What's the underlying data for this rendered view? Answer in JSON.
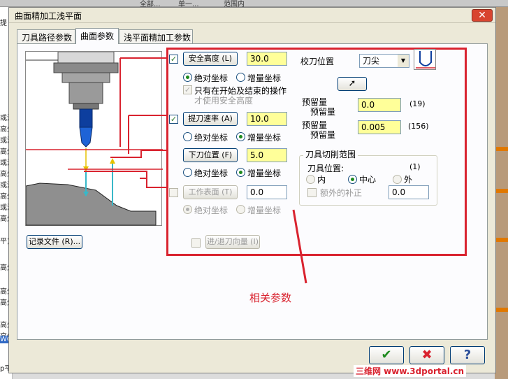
{
  "background": {
    "toolbar_items": [
      "全部...",
      "单一...",
      "范围内"
    ],
    "left_texts": [
      "提",
      "或清",
      "高外",
      "或清",
      "高外",
      "或清",
      "高外",
      "或清",
      "高外",
      "或清",
      "高外",
      "平)",
      "高外",
      "高外",
      "高外",
      "高外",
      "高外",
      "WCS",
      "p平"
    ]
  },
  "dialog": {
    "title": "曲面精加工浅平面",
    "close_glyph": "✕",
    "tabs": [
      "刀具路径参数",
      "曲面参数",
      "浅平面精加工参数"
    ]
  },
  "form": {
    "safe_height": {
      "label": "安全高度 (L)",
      "value": "30.0",
      "checked": "✓"
    },
    "safe_abs": "绝对坐标",
    "safe_inc": "增量坐标",
    "only_start_end": "只有在开始及结束的操作",
    "only_start_end2": "才使用安全高度",
    "retract": {
      "label": "提刀速率 (A)",
      "value": "10.0",
      "checked": "✓"
    },
    "retract_abs": "绝对坐标",
    "retract_inc": "增量坐标",
    "feed_plane": {
      "label": "下刀位置 (F)",
      "value": "5.0"
    },
    "feed_abs": "绝对坐标",
    "feed_inc": "增量坐标",
    "top_of_stock": {
      "label": "工作表面 (T)",
      "value": "0.0"
    },
    "top_abs": "绝对坐标",
    "top_inc": "增量坐标",
    "tip_comp_label": "校刀位置",
    "tip_comp_value": "刀尖",
    "stock_to_leave_1a": "预留量",
    "stock_to_leave_1b": "预留量",
    "stock_value_1": "0.0",
    "stock_count_1": "(19)",
    "stock_to_leave_2a": "预留量",
    "stock_to_leave_2b": "预留量",
    "stock_value_2": "0.005",
    "stock_count_2": "(156)",
    "cut_range_title": "刀具切削范围",
    "tool_position_label": "刀具位置:",
    "tool_position_count": "(1)",
    "pos_inside": "内",
    "pos_center": "中心",
    "pos_outside": "外",
    "extra_comp_label": "额外的补正",
    "extra_comp_value": "0.0",
    "entry_exit_btn": "进/退刀向量 (I)",
    "record_file_btn": "记录文件 (R)..."
  },
  "annotation": "相关参数",
  "buttons": {
    "ok": "✔",
    "cancel": "✖",
    "help": "?"
  },
  "watermark": "三维网 www.3dportal.cn",
  "colors": {
    "highlight_red": "#d9232f",
    "input_yellow": "#ffff99"
  }
}
